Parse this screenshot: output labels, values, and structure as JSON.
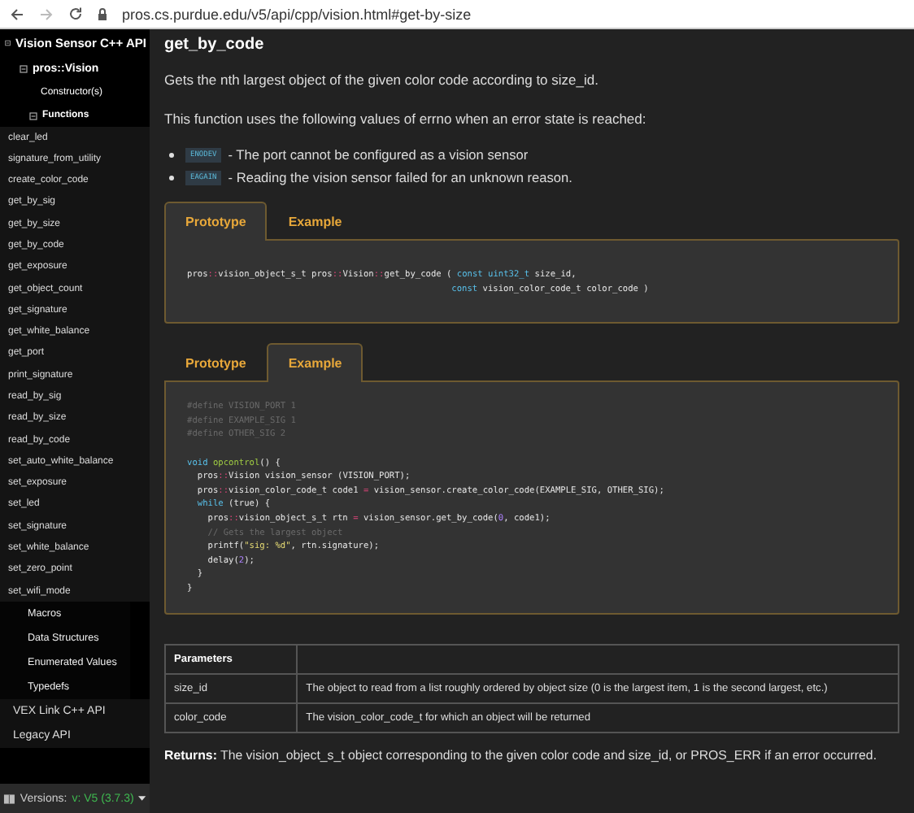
{
  "browser": {
    "url": "pros.cs.purdue.edu/v5/api/cpp/vision.html#get-by-size"
  },
  "sidebar": {
    "tree": [
      {
        "label": "Vision Sensor C++ API",
        "expanded": true,
        "children": [
          {
            "label": "pros::Vision",
            "expanded": true,
            "children": [
              {
                "label": "Constructor(s)"
              },
              {
                "label": "Functions",
                "expanded": true,
                "children": [
                  {
                    "label": "clear_led"
                  },
                  {
                    "label": "signature_from_utility"
                  },
                  {
                    "label": "create_color_code"
                  },
                  {
                    "label": "get_by_sig"
                  },
                  {
                    "label": "get_by_size"
                  },
                  {
                    "label": "get_by_code"
                  },
                  {
                    "label": "get_exposure"
                  },
                  {
                    "label": "get_object_count"
                  },
                  {
                    "label": "get_signature"
                  },
                  {
                    "label": "get_white_balance"
                  },
                  {
                    "label": "get_port"
                  },
                  {
                    "label": "print_signature"
                  },
                  {
                    "label": "read_by_sig"
                  },
                  {
                    "label": "read_by_size"
                  },
                  {
                    "label": "read_by_code"
                  },
                  {
                    "label": "set_auto_white_balance"
                  },
                  {
                    "label": "set_exposure"
                  },
                  {
                    "label": "set_led"
                  },
                  {
                    "label": "set_signature"
                  },
                  {
                    "label": "set_white_balance"
                  },
                  {
                    "label": "set_zero_point"
                  },
                  {
                    "label": "set_wifi_mode"
                  }
                ]
              }
            ]
          },
          {
            "label": "Macros"
          },
          {
            "label": "Data Structures"
          },
          {
            "label": "Enumerated Values"
          },
          {
            "label": "Typedefs"
          }
        ]
      },
      {
        "label": "VEX Link C++ API"
      },
      {
        "label": "Legacy API"
      }
    ],
    "versions": {
      "label": "Versions:",
      "value": "v: V5 (3.7.3)"
    }
  },
  "title": "get_by_code",
  "paragraphs": [
    "Gets the nth largest object of the given color code according to size_id.",
    "This function uses the following values of errno when an error state is reached:"
  ],
  "errors": [
    {
      "code": "ENODEV",
      "text": "- The port cannot be configured as a vision sensor"
    },
    {
      "code": "EAGAIN",
      "text": "- Reading the vision sensor failed for an unknown reason."
    }
  ],
  "tab_panels": [
    {
      "tabs": [
        {
          "label": "Prototype",
          "selected": true
        },
        {
          "label": "Example",
          "selected": false
        }
      ],
      "lines": [
        {
          "kind": "code",
          "tokens": [
            {
              "t": "pros",
              "kind": "plain"
            },
            {
              "t": "::",
              "kind": "operator"
            },
            {
              "t": "vision_object_s_t pros",
              "kind": "plain"
            },
            {
              "t": "::",
              "kind": "operator"
            },
            {
              "t": "Vision",
              "kind": "plain"
            },
            {
              "t": "::",
              "kind": "operator"
            },
            {
              "t": "get_by_code (",
              "kind": "plain"
            },
            {
              "t": " const uint32_t",
              "kind": "keyword"
            },
            {
              "t": " size_id,",
              "kind": "plain"
            }
          ]
        },
        {
          "kind": "code",
          "tokens": [
            {
              "t": "                                                   const",
              "kind": "keyword"
            },
            {
              "t": " vision_color_code_t color_code )",
              "kind": "plain"
            }
          ]
        }
      ]
    },
    {
      "tabs": [
        {
          "label": "Prototype",
          "selected": false
        },
        {
          "label": "Example",
          "selected": true
        }
      ],
      "lines": [
        {
          "kind": "code",
          "tokens": [
            {
              "t": "#define VISION_PORT 1",
              "kind": "comment"
            }
          ]
        },
        {
          "kind": "code",
          "tokens": [
            {
              "t": "#define EXAMPLE_SIG 1",
              "kind": "comment"
            }
          ]
        },
        {
          "kind": "code",
          "tokens": [
            {
              "t": "#define OTHER_SIG 2",
              "kind": "comment"
            }
          ]
        },
        {
          "kind": "blank"
        },
        {
          "kind": "code",
          "tokens": [
            {
              "t": "void",
              "kind": "keyword"
            },
            {
              "t": " opcontrol",
              "kind": "function"
            },
            {
              "t": "() {",
              "kind": "plain"
            }
          ]
        },
        {
          "kind": "code",
          "tokens": [
            {
              "t": "  pros",
              "kind": "plain"
            },
            {
              "t": "::",
              "kind": "operator"
            },
            {
              "t": "Vision vision_sensor (VISION_PORT);",
              "kind": "plain"
            }
          ]
        },
        {
          "kind": "code",
          "tokens": [
            {
              "t": "  pros",
              "kind": "plain"
            },
            {
              "t": "::",
              "kind": "operator"
            },
            {
              "t": "vision_color_code_t code1 ",
              "kind": "plain"
            },
            {
              "t": "=",
              "kind": "operator"
            },
            {
              "t": " vision_sensor.create_color_code(EXAMPLE_SIG, OTHER_SIG);",
              "kind": "plain"
            }
          ]
        },
        {
          "kind": "code",
          "tokens": [
            {
              "t": "  while",
              "kind": "keyword"
            },
            {
              "t": " (true) {",
              "kind": "plain"
            }
          ]
        },
        {
          "kind": "code",
          "tokens": [
            {
              "t": "    pros",
              "kind": "plain"
            },
            {
              "t": "::",
              "kind": "operator"
            },
            {
              "t": "vision_object_s_t rtn ",
              "kind": "plain"
            },
            {
              "t": "=",
              "kind": "operator"
            },
            {
              "t": " vision_sensor.get_by_code(",
              "kind": "plain"
            },
            {
              "t": "0",
              "kind": "number"
            },
            {
              "t": ", code1);",
              "kind": "plain"
            }
          ]
        },
        {
          "kind": "code",
          "tokens": [
            {
              "t": "    // Gets the largest object",
              "kind": "comment"
            }
          ]
        },
        {
          "kind": "code",
          "tokens": [
            {
              "t": "    printf(",
              "kind": "plain"
            },
            {
              "t": "\"sig: %d\"",
              "kind": "string"
            },
            {
              "t": ", rtn.signature);",
              "kind": "plain"
            }
          ]
        },
        {
          "kind": "code",
          "tokens": [
            {
              "t": "    delay(",
              "kind": "plain"
            },
            {
              "t": "2",
              "kind": "number"
            },
            {
              "t": ");",
              "kind": "plain"
            }
          ]
        },
        {
          "kind": "code",
          "tokens": [
            {
              "t": "  }",
              "kind": "plain"
            }
          ]
        },
        {
          "kind": "code",
          "tokens": [
            {
              "t": "}",
              "kind": "plain"
            }
          ]
        }
      ]
    }
  ],
  "parameters": {
    "columns": [
      "Parameters"
    ],
    "rows": [
      [
        "size_id",
        "The object to read from a list roughly ordered by object size (0 is the largest item, 1 is the second largest, etc.)"
      ],
      [
        "color_code",
        "The vision_color_code_t for which an object will be returned"
      ]
    ]
  },
  "returns": "**Returns:** The vision_object_s_t object corresponding to the given color code and size_id, or PROS_ERR if an error occurred."
}
